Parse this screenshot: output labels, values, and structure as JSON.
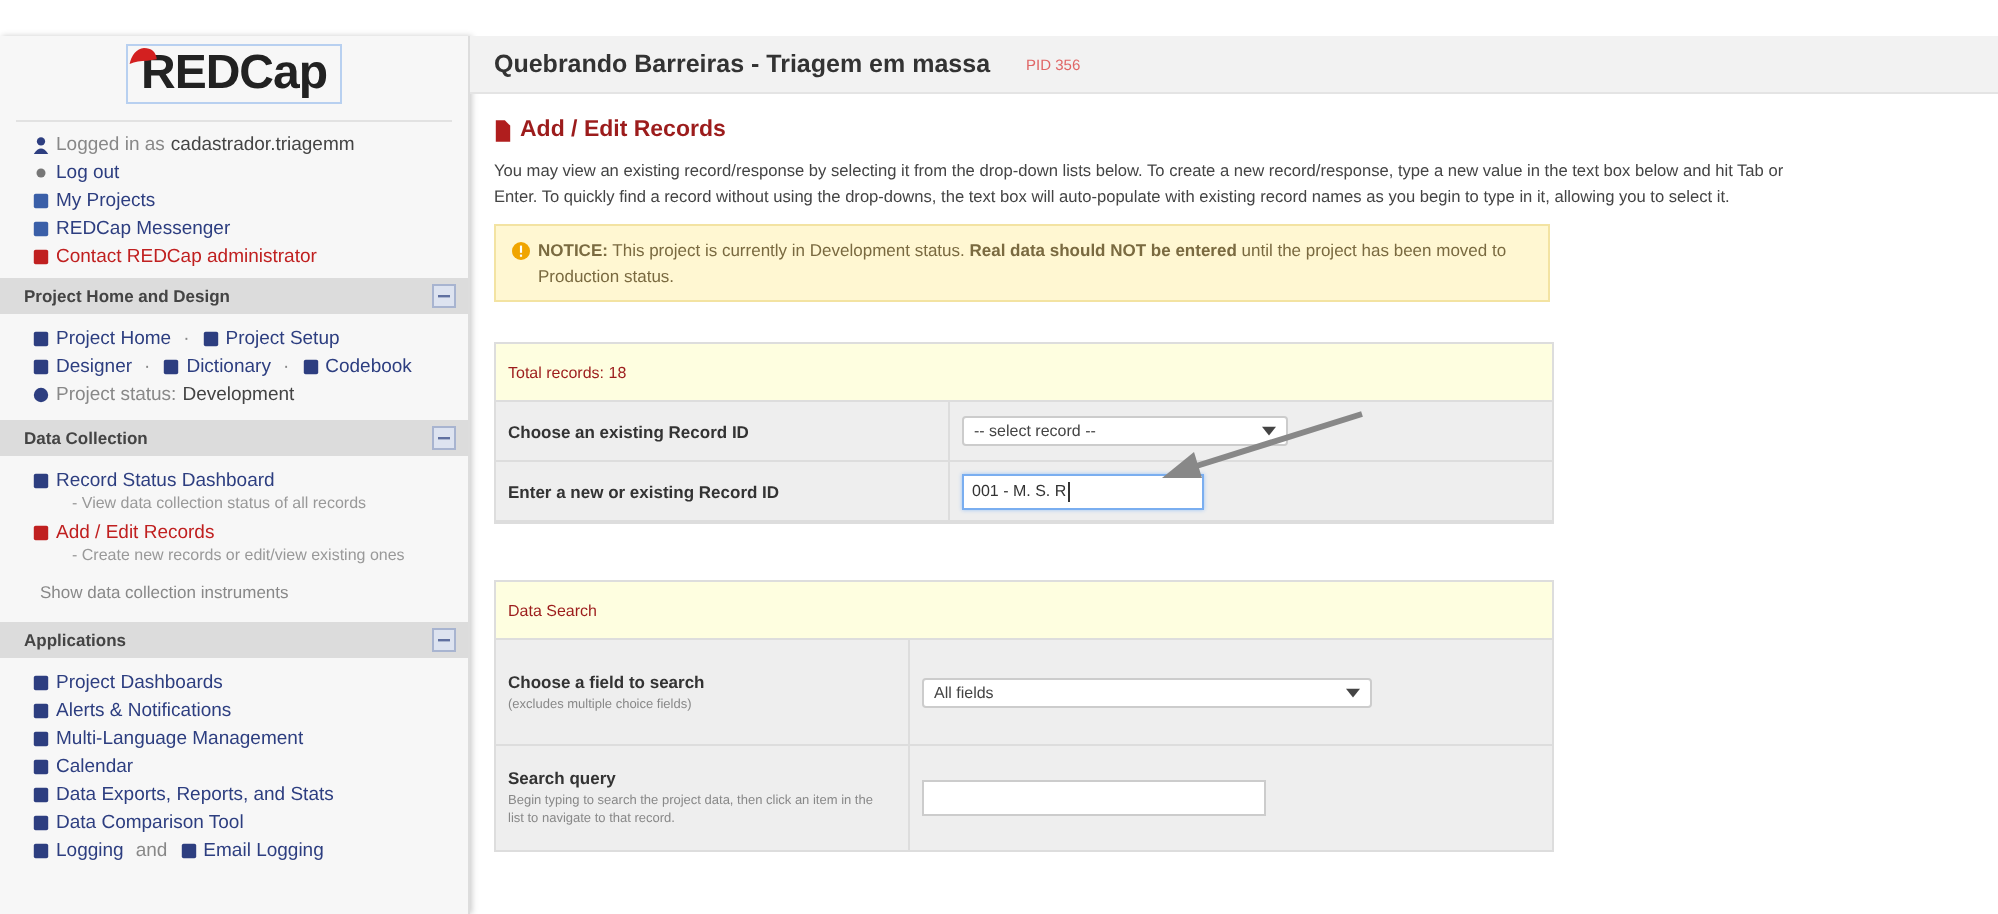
{
  "sidebar": {
    "logo": "REDCap",
    "logged_in": {
      "label": "Logged in as",
      "user": "cadastrador.triagemm"
    },
    "logout": "Log out",
    "links": [
      {
        "label": "My Projects",
        "kind": "normal"
      },
      {
        "label": "REDCap Messenger",
        "kind": "normal"
      },
      {
        "label": "Contact REDCap administrator",
        "kind": "alert"
      }
    ],
    "sections": [
      {
        "title": "Project Home and Design",
        "lines": [
          {
            "kind": "links",
            "separator": "·",
            "links": [
              {
                "label": "Project Home",
                "selected": false
              },
              {
                "label": "Project Setup",
                "selected": false
              }
            ]
          },
          {
            "kind": "links",
            "separator": "·",
            "links": [
              {
                "label": "Designer",
                "selected": false
              },
              {
                "label": "Dictionary",
                "selected": false
              },
              {
                "label": "Codebook",
                "selected": false
              }
            ]
          },
          {
            "kind": "status",
            "label": "Project status:",
            "value": "Development"
          }
        ]
      },
      {
        "title": "Data Collection",
        "lines": [
          {
            "kind": "links",
            "links": [
              {
                "label": "Record Status Dashboard",
                "selected": false
              }
            ],
            "note": "- View data collection status of all records"
          },
          {
            "kind": "links",
            "links": [
              {
                "label": "Add / Edit Records",
                "selected": true
              }
            ],
            "note": "- Create new records or edit/view existing ones"
          },
          {
            "kind": "text",
            "text": "Show data collection instruments"
          }
        ]
      },
      {
        "title": "Applications",
        "lines": [
          {
            "kind": "links",
            "links": [
              {
                "label": "Project Dashboards",
                "selected": false
              }
            ]
          },
          {
            "kind": "links",
            "links": [
              {
                "label": "Alerts & Notifications",
                "selected": false
              }
            ]
          },
          {
            "kind": "links",
            "links": [
              {
                "label": "Multi-Language Management",
                "selected": false
              }
            ]
          },
          {
            "kind": "links",
            "links": [
              {
                "label": "Calendar",
                "selected": false
              }
            ]
          },
          {
            "kind": "links",
            "links": [
              {
                "label": "Data Exports, Reports, and Stats",
                "selected": false
              }
            ]
          },
          {
            "kind": "links",
            "links": [
              {
                "label": "Data Comparison Tool",
                "selected": false
              }
            ]
          },
          {
            "kind": "links",
            "separator": "and",
            "links": [
              {
                "label": "Logging",
                "selected": false
              },
              {
                "label": "Email Logging",
                "selected": false
              }
            ]
          }
        ]
      }
    ]
  },
  "header": {
    "title": "Quebrando Barreiras - Triagem em massa",
    "pid": "PID 356"
  },
  "page": {
    "title": "Add / Edit Records",
    "intro": "You may view an existing record/response by selecting it from the drop-down lists below. To create a new record/response, type a new value in the text box below and hit Tab or Enter. To quickly find a record without using the drop-downs, the text box will auto-populate with existing record names as you begin to type in it, allowing you to select it.",
    "notice": "**NOTICE:** This project is currently in Development status. **Real data should NOT be entered** until the project has been moved to Production status."
  },
  "record_table": {
    "title": "Total records: 18",
    "rows": [
      {
        "kind": "select",
        "label": "Choose an existing Record ID",
        "value": "-- select record --"
      },
      {
        "kind": "input",
        "label": "Enter a new or existing Record ID",
        "value": "001 - M. S. R"
      }
    ]
  },
  "search_table": {
    "title": "Data Search",
    "rows": [
      {
        "kind": "select",
        "label": "Choose a field to search",
        "hint": "(excludes multiple choice fields)",
        "value": "All fields"
      },
      {
        "kind": "input",
        "label": "Search query",
        "hint": "Begin typing to search the project data, then click an item in the list to navigate to that record."
      }
    ]
  }
}
